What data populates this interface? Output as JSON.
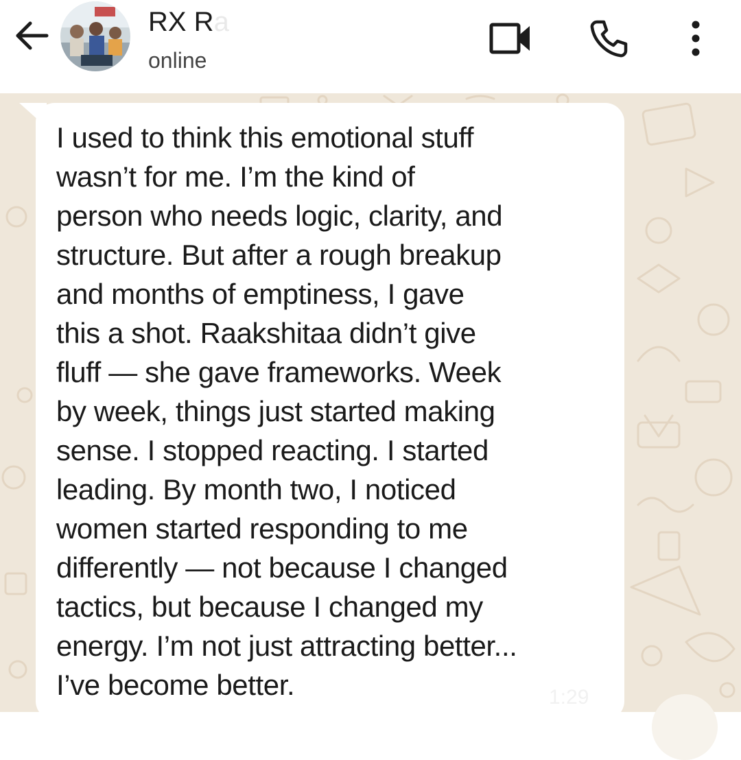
{
  "header": {
    "contact_name_visible": "RX R",
    "contact_name_faded": "a",
    "status": "online",
    "icons": {
      "back": "back-arrow-icon",
      "video": "video-call-icon",
      "call": "phone-call-icon",
      "menu": "more-vert-icon"
    }
  },
  "message": {
    "lines": [
      "I used to think this emotional stuff",
      "wasn’t for me. I’m the kind of",
      "person who needs logic, clarity, and",
      "structure. But after a rough breakup",
      "and months of emptiness, I gave",
      "this a shot. Raakshitaa didn’t give",
      "fluff — she gave frameworks. Week",
      "by week, things just started making",
      "sense. I stopped reacting. I started",
      "leading. By month two, I noticed",
      "women started responding to me",
      "differently — not because I changed",
      "tactics, but because I changed my",
      "energy. I’m not just attracting better...",
      "I’ve become better."
    ],
    "time": "1:29"
  },
  "colors": {
    "chat_background": "#efe7da",
    "bubble": "#ffffff",
    "text": "#1a1a1a"
  }
}
